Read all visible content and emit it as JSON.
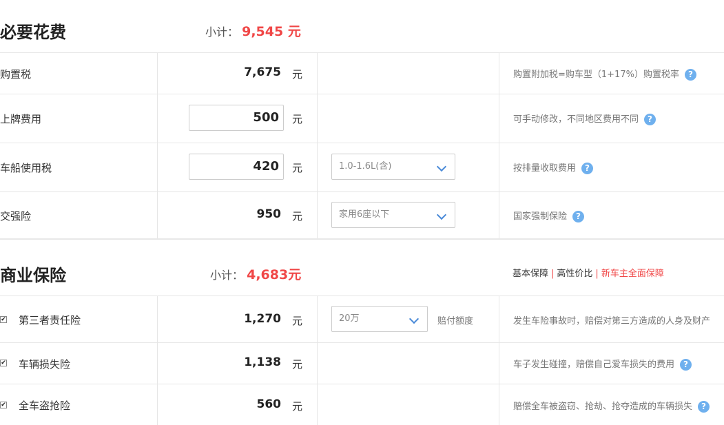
{
  "required": {
    "title": "必要花费",
    "subtotal_label": "小计：",
    "subtotal_value": "9,545 元",
    "rows": [
      {
        "label": "购置税",
        "value": "7,675",
        "unit": "元",
        "desc": "购置附加税=购车型（1+17%）购置税率"
      },
      {
        "label": "上牌费用",
        "value": "500",
        "unit": "元",
        "desc": "可手动修改，不同地区费用不同"
      },
      {
        "label": "车船使用税",
        "value": "420",
        "unit": "元",
        "select": "1.0-1.6L(含)",
        "desc": "按排量收取费用"
      },
      {
        "label": "交强险",
        "value": "950",
        "unit": "元",
        "select": "家用6座以下",
        "desc": "国家强制保险"
      }
    ]
  },
  "commercial": {
    "title": "商业保险",
    "subtotal_label": "小计：",
    "subtotal_value": "4,683元",
    "tabs": [
      "基本保障",
      "高性价比",
      "新车主全面保障"
    ],
    "rows": [
      {
        "label": "第三者责任险",
        "value": "1,270",
        "unit": "元",
        "select": "20万",
        "select_note": "赔付额度",
        "desc": "发生车险事故时，赔偿对第三方造成的人身及财产",
        "checked": true
      },
      {
        "label": "车辆损失险",
        "value": "1,138",
        "unit": "元",
        "desc": "车子发生碰撞，赔偿自己爱车损失的费用",
        "checked": true
      },
      {
        "label": "全车盗抢险",
        "value": "560",
        "unit": "元",
        "desc": "赔偿全车被盗窃、抢劫、抢夺造成的车辆损失",
        "checked": true
      }
    ]
  },
  "help_glyph": "?",
  "check_glyph": "✔",
  "colors": {
    "accent_red": "#f04747",
    "help_blue": "#6fb0ee",
    "chevron_blue": "#4a8ad8"
  }
}
